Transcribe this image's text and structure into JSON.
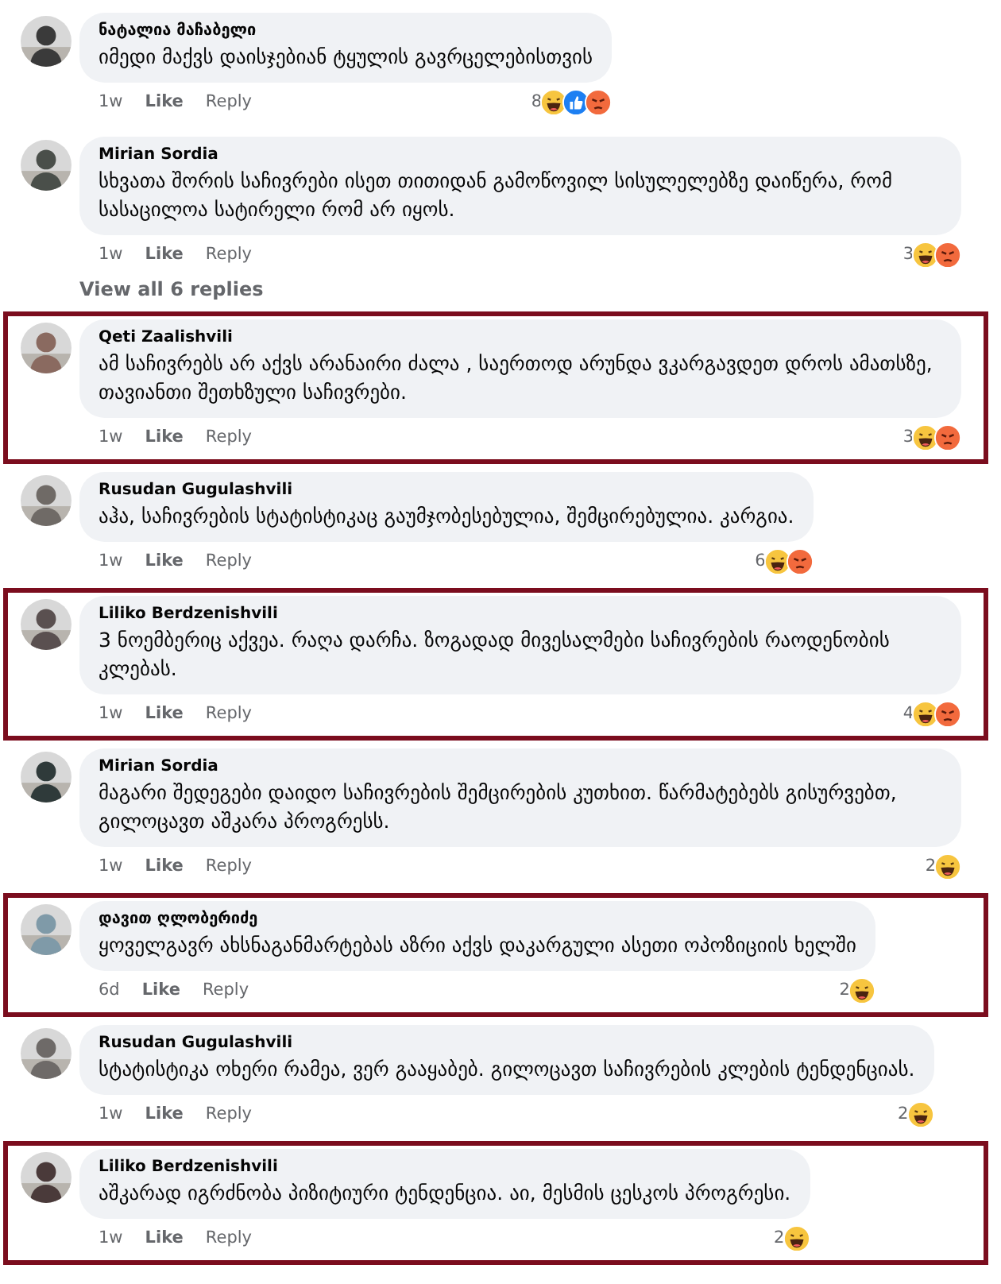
{
  "comments": [
    {
      "author": "ნატალია მაჩაბელი",
      "text": "იმედი მაქვს დაისჯებიან ტყულის გავრცელებისთვის",
      "time": "1w",
      "like": "Like",
      "reply": "Reply",
      "reaction_count": "8",
      "reactions": [
        {
          "kind": "haha"
        },
        {
          "kind": "like"
        },
        {
          "kind": "angry"
        }
      ],
      "highlighted": false
    },
    {
      "author": "Mirian Sordia",
      "text": "სხვათა შორის საჩივრები ისეთ თითიდან გამოწოვილ სისულელებზე დაიწერა, რომ სასაცილოა სატირელი რომ არ იყოს.",
      "time": "1w",
      "like": "Like",
      "reply": "Reply",
      "reaction_count": "3",
      "reactions": [
        {
          "kind": "haha"
        },
        {
          "kind": "angry"
        }
      ],
      "highlighted": false,
      "more_replies": "View all 6 replies"
    },
    {
      "author": "Qeti Zaalishvili",
      "text": "ამ საჩივრებს არ აქვს არანაირი ძალა , საერთოდ არუნდა ვკარგავდეთ დროს ამათსზე, თავიანთი შეთხზული საჩივრები.",
      "time": "1w",
      "like": "Like",
      "reply": "Reply",
      "reaction_count": "3",
      "reactions": [
        {
          "kind": "haha"
        },
        {
          "kind": "angry"
        }
      ],
      "highlighted": true
    },
    {
      "author": "Rusudan Gugulashvili",
      "text": "აჰა, საჩივრების სტატისტიკაც გაუმჯობესებულია, შემცირებულია. კარგია.",
      "time": "1w",
      "like": "Like",
      "reply": "Reply",
      "reaction_count": "6",
      "reactions": [
        {
          "kind": "haha"
        },
        {
          "kind": "angry"
        }
      ],
      "highlighted": false
    },
    {
      "author": "Liliko Berdzenishvili",
      "text": "3 ნოემბერიც აქვეა. რაღა დარჩა. ზოგადად მივესალმები საჩივრების რაოდენობის კლებას.",
      "time": "1w",
      "like": "Like",
      "reply": "Reply",
      "reaction_count": "4",
      "reactions": [
        {
          "kind": "haha"
        },
        {
          "kind": "angry"
        }
      ],
      "highlighted": true
    },
    {
      "author": "Mirian Sordia",
      "text": "მაგარი შედეგები დაიდო საჩივრების შემცირების კუთხით. წარმატებებს გისურვებთ, გილოცავთ აშკარა პროგრესს.",
      "time": "1w",
      "like": "Like",
      "reply": "Reply",
      "reaction_count": "2",
      "reactions": [
        {
          "kind": "haha"
        }
      ],
      "highlighted": false
    },
    {
      "author": "დავით ღლობერიძე",
      "text": "ყოველგავრ ახსნაგანმარტებას აზრი აქვს დაკარგული ასეთი ოპოზიციის ხელში",
      "time": "6d",
      "like": "Like",
      "reply": "Reply",
      "reaction_count": "2",
      "reactions": [
        {
          "kind": "haha"
        }
      ],
      "highlighted": true
    },
    {
      "author": "Rusudan Gugulashvili",
      "text": "სტატისტიკა ოხერი რამეა, ვერ გააყაბებ. გილოცავთ საჩივრების კლების ტენდენციას.",
      "time": "1w",
      "like": "Like",
      "reply": "Reply",
      "reaction_count": "2",
      "reactions": [
        {
          "kind": "haha"
        }
      ],
      "highlighted": false
    },
    {
      "author": "Liliko Berdzenishvili",
      "text": "აშკარად იგრძნობა პიზიტიური ტენდენცია. აი, მესმის ცესკოს პროგრესი.",
      "time": "1w",
      "like": "Like",
      "reply": "Reply",
      "reaction_count": "2",
      "reactions": [
        {
          "kind": "haha"
        }
      ],
      "highlighted": true
    }
  ]
}
